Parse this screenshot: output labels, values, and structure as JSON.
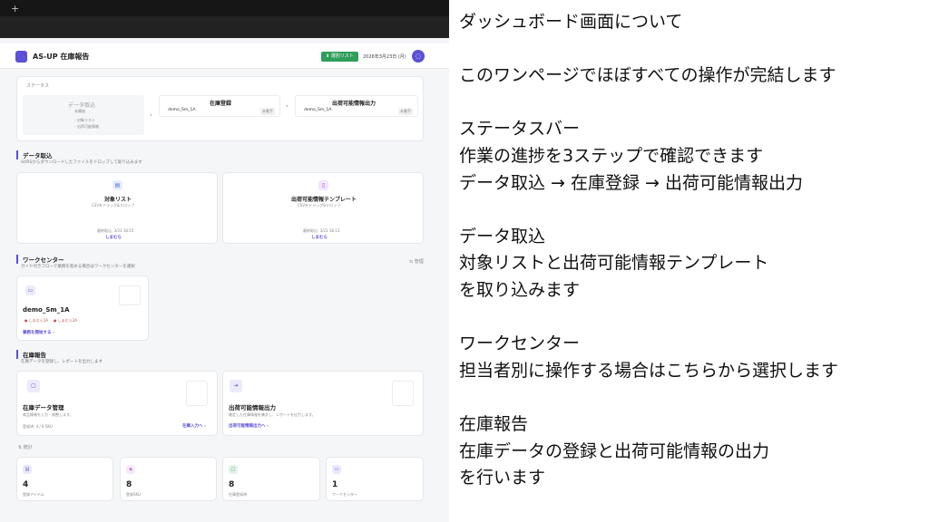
{
  "browser": {
    "new_tab": "+"
  },
  "header": {
    "title": "AS-UP 在庫報告",
    "list_button": "選別リスト",
    "date": "2026年3月23日 (月)",
    "chat_icon": "chat-icon"
  },
  "status": {
    "label": "ステータス",
    "steps": [
      {
        "title": "データ取込",
        "state": "未開始",
        "items": [
          "・対象リスト",
          "・出荷可能情報"
        ]
      },
      {
        "title": "在庫登録",
        "value": "demo_Sm_1A",
        "badge": "未着手"
      },
      {
        "title": "出荷可能情報出力",
        "value": "demo_Sm_1A",
        "badge": "未着手"
      }
    ]
  },
  "import": {
    "title": "データ取込",
    "subtitle": "SORSからダウンロードしたファイルをドロップして取り込みます",
    "cards": [
      {
        "title": "対象リスト",
        "hint": "CSVをドラッグ&ドロップ",
        "meta": "最終取込: 3/23 18:15",
        "link": "しまむら"
      },
      {
        "title": "出荷可能情報テンプレート",
        "hint": "CSVをドラッグ&ドロップ",
        "meta": "最終取込: 3/23 18:13",
        "link": "しまむら"
      }
    ]
  },
  "workcenter": {
    "title": "ワークセンター",
    "subtitle": "ガイド付きフローで業務を進める場合はワークセンターを選択",
    "settings": "管理",
    "card": {
      "name": "demo_Sm_1A",
      "tags": [
        "しまむら1A",
        "しまむら2A"
      ],
      "link": "業務を開始する ›"
    }
  },
  "report": {
    "title": "在庫報告",
    "subtitle": "在庫データを登録し、レポートを出力します",
    "cards": [
      {
        "title": "在庫データ管理",
        "desc": "商品情報を入力・調整します。",
        "meta": "登録済: 4 / 8 SKU",
        "link": "在庫入力へ ›"
      },
      {
        "title": "出荷可能情報出力",
        "desc": "確定した在庫情報を集計し、レポートを出力します。",
        "link": "出荷可能情報出力へ ›"
      }
    ]
  },
  "stats": {
    "title": "統計",
    "items": [
      {
        "value": "4",
        "label": "登録アイテム",
        "color": "#5b50d6"
      },
      {
        "value": "8",
        "label": "登録SKU",
        "color": "#b34fc9"
      },
      {
        "value": "8",
        "label": "在庫登録済",
        "color": "#2f9e5b"
      },
      {
        "value": "1",
        "label": "ワークセンター",
        "color": "#5b50d6"
      }
    ]
  },
  "notes": {
    "lines": [
      "ダッシュボード画面について",
      "",
      "このワンページでほぼすべての操作が完結します",
      "",
      "ステータスバー",
      "作業の進捗を3ステップで確認できます",
      "データ取込 → 在庫登録 → 出荷可能情報出力",
      "",
      "データ取込",
      "対象リストと出荷可能情報テンプレート",
      "を取り込みます",
      "",
      "ワークセンター",
      "担当者別に操作する場合はこちらから選択します",
      "",
      "在庫報告",
      "在庫データの登録と出荷可能情報の出力",
      "を行います"
    ]
  }
}
